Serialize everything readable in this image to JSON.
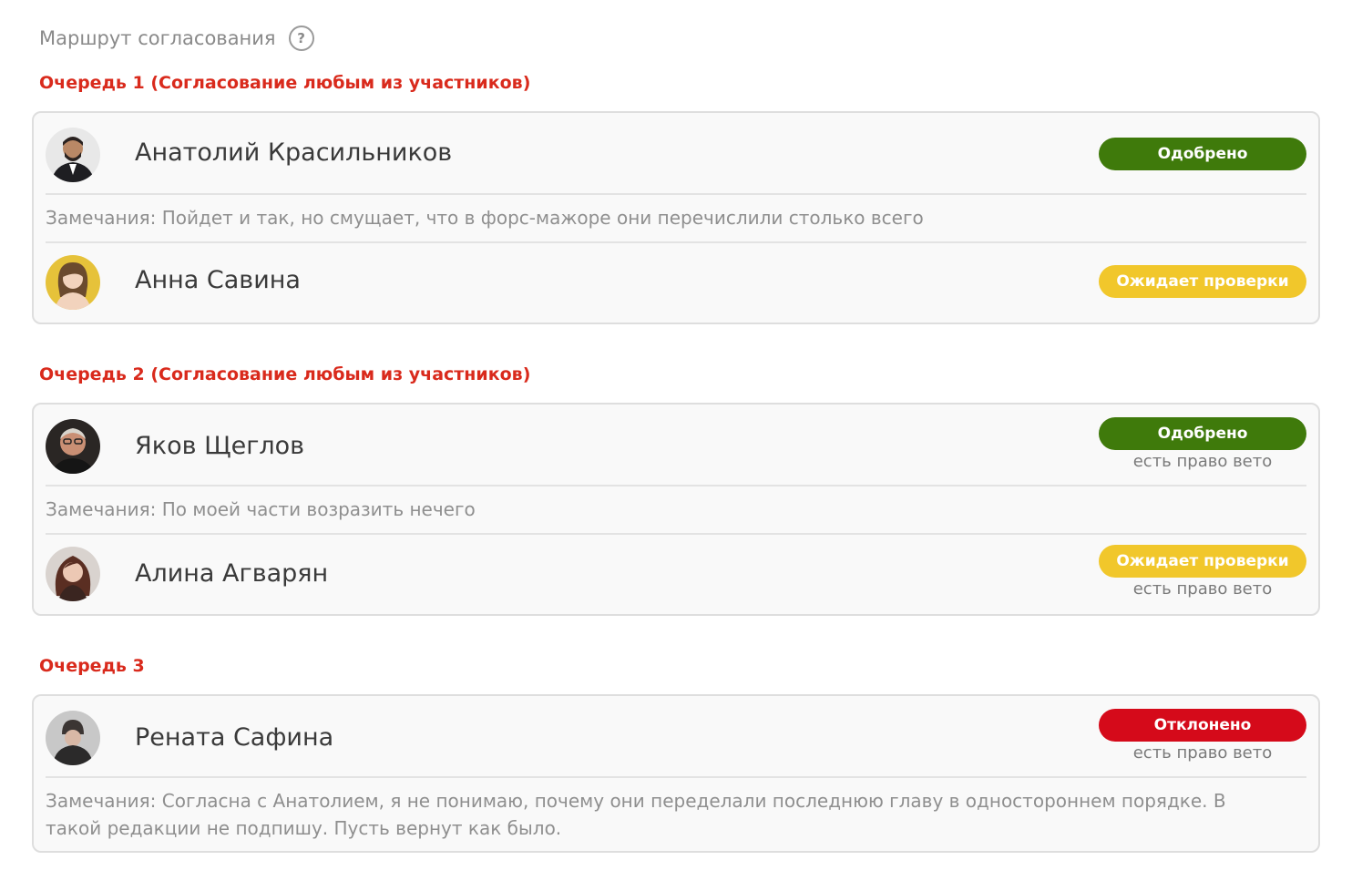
{
  "header": {
    "title": "Маршрут согласования",
    "help_icon": "question-circle-icon"
  },
  "queues": [
    {
      "title": "Очередь 1 (Согласование любым из участников)",
      "approvers": [
        {
          "name": "Анатолий Красильников",
          "status": "Одобрено",
          "status_type": "approved",
          "veto": "",
          "comment": "Замечания: Пойдет и так, но смущает, что в форс-мажоре они перечислили столько всего"
        },
        {
          "name": "Анна Савина",
          "status": "Ожидает проверки",
          "status_type": "pending",
          "veto": "",
          "comment": ""
        }
      ]
    },
    {
      "title": "Очередь 2 (Согласование любым из участников)",
      "approvers": [
        {
          "name": "Яков Щеглов",
          "status": "Одобрено",
          "status_type": "approved",
          "veto": "есть право вето",
          "comment": "Замечания: По моей части возразить нечего"
        },
        {
          "name": "Алина Агварян",
          "status": "Ожидает проверки",
          "status_type": "pending",
          "veto": "есть право вето",
          "comment": ""
        }
      ]
    },
    {
      "title": "Очередь 3",
      "approvers": [
        {
          "name": "Рената Сафина",
          "status": "Отклонено",
          "status_type": "rejected",
          "veto": "есть право вето",
          "comment": "Замечания: Согласна с Анатолием, я не понимаю, почему они переделали последнюю главу в одностороннем порядке. В такой редакции не подпишу. Пусть вернут как было."
        }
      ]
    }
  ],
  "colors": {
    "approved": "#3f7a0b",
    "pending": "#f1c72b",
    "rejected": "#d50a1a",
    "queue_title": "#d92a1c"
  }
}
